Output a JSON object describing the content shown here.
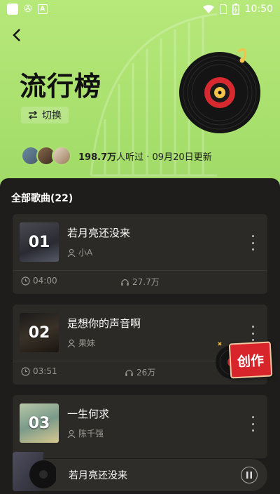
{
  "status_bar": {
    "icons": [
      "app-square-icon",
      "chinese-glyph-icon",
      "a-icon",
      "wifi-icon",
      "sim-icon",
      "battery-icon"
    ],
    "glyph": "ᠲᠣ",
    "time": "10:50"
  },
  "header": {
    "back_icon": "back-arrow-icon",
    "title": "流行榜",
    "switch_label": "切换",
    "listeners": "198.7万",
    "listen_suffix": "人听过 · 09月20日更新"
  },
  "list": {
    "count_label": "全部歌曲(22)",
    "songs": [
      {
        "rank": "01",
        "name": "若月亮还没来",
        "artist": "小A",
        "duration": "04:00",
        "plays": "27.7万"
      },
      {
        "rank": "02",
        "name": "是想你的声音啊",
        "artist": "果妹",
        "duration": "03:51",
        "plays": "26万"
      },
      {
        "rank": "03",
        "name": "一生何求",
        "artist": "陈千强"
      }
    ]
  },
  "create_button": "创作",
  "player": {
    "title": "若月亮还没来"
  },
  "colors": {
    "hero_green": "#a8e06d",
    "panel": "#1e1d1b",
    "card": "#2b2a27",
    "accent_red": "#d7252b"
  }
}
